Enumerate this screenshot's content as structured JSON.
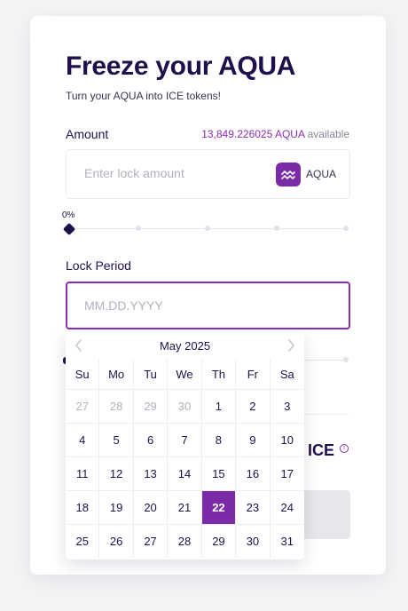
{
  "form": {
    "title": "Freeze your AQUA",
    "subtitle": "Turn your AQUA into ICE tokens!",
    "amount_label": "Amount",
    "available_amount": "13,849.226025 AQUA",
    "available_suffix": " available",
    "amount_placeholder": "Enter lock amount",
    "token_name": "AQUA",
    "token_icon": "aqua-wave-icon",
    "percent_label": "0%",
    "percent_value": 0,
    "lock_period_label": "Lock Period",
    "date_placeholder": "MM.DD.YYYY",
    "ice_label": "ICE"
  },
  "calendar": {
    "month_title": "May 2025",
    "weekdays": [
      "Su",
      "Mo",
      "Tu",
      "We",
      "Th",
      "Fr",
      "Sa"
    ],
    "days": [
      {
        "label": "27",
        "muted": true
      },
      {
        "label": "28",
        "muted": true
      },
      {
        "label": "29",
        "muted": true
      },
      {
        "label": "30",
        "muted": true
      },
      {
        "label": "1"
      },
      {
        "label": "2"
      },
      {
        "label": "3"
      },
      {
        "label": "4"
      },
      {
        "label": "5"
      },
      {
        "label": "6"
      },
      {
        "label": "7"
      },
      {
        "label": "8"
      },
      {
        "label": "9"
      },
      {
        "label": "10"
      },
      {
        "label": "11"
      },
      {
        "label": "12"
      },
      {
        "label": "13"
      },
      {
        "label": "14"
      },
      {
        "label": "15"
      },
      {
        "label": "16"
      },
      {
        "label": "17"
      },
      {
        "label": "18"
      },
      {
        "label": "19"
      },
      {
        "label": "20"
      },
      {
        "label": "21"
      },
      {
        "label": "22",
        "selected": true
      },
      {
        "label": "23"
      },
      {
        "label": "24"
      },
      {
        "label": "25"
      },
      {
        "label": "26"
      },
      {
        "label": "27"
      },
      {
        "label": "28"
      },
      {
        "label": "29"
      },
      {
        "label": "30"
      },
      {
        "label": "31"
      }
    ]
  },
  "colors": {
    "accent": "#8e2ab8",
    "selected_bg": "#7b2aa8",
    "text": "#1f0f4d",
    "muted": "#b5b0bf"
  }
}
